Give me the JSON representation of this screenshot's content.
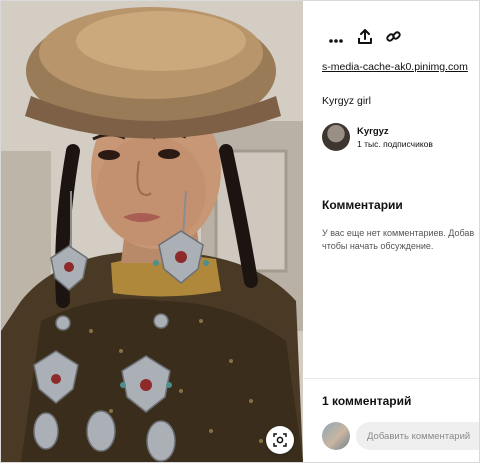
{
  "toolbar": {
    "more_icon": "more-horizontal-icon",
    "share_icon": "share-upload-icon",
    "link_icon": "link-chain-icon"
  },
  "pin": {
    "source_domain": "s-media-cache-ak0.pinimg.com",
    "title": "Kyrgyz girl"
  },
  "creator": {
    "name": "Kyrgyz",
    "followers": "1 тыс. подписчиков"
  },
  "comments": {
    "heading": "Комментарии",
    "empty_line1": "У вас еще нет комментариев. Добав",
    "empty_line2": "чтобы начать обсуждение.",
    "count_label": "1 комментарий",
    "input_placeholder": "Добавить комментарий"
  },
  "image": {
    "lens_icon": "visual-search-icon"
  },
  "colors": {
    "background": "#ffffff",
    "input_bg": "#efefef",
    "text": "#111111",
    "muted_text": "#555555"
  }
}
